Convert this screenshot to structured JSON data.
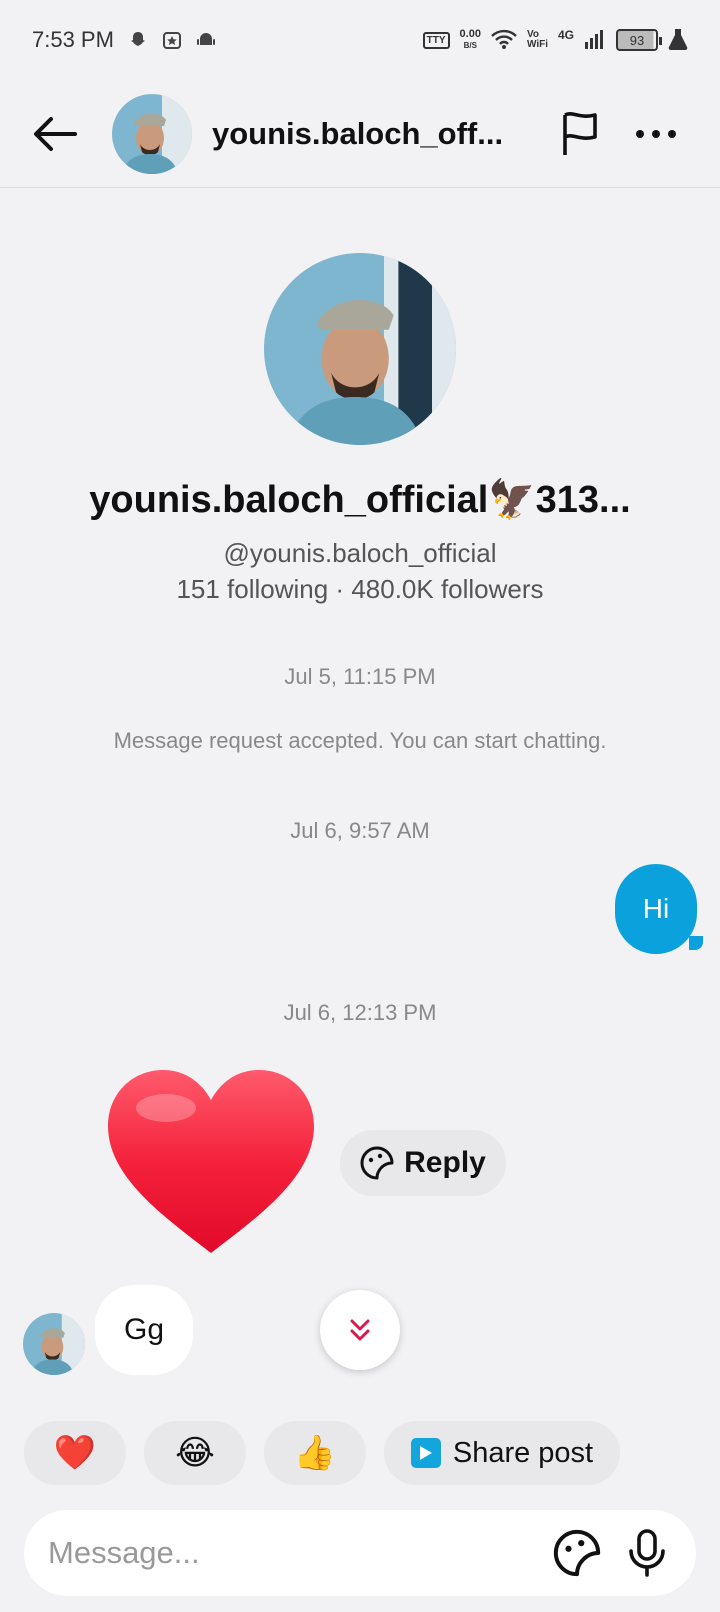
{
  "status_bar": {
    "time": "7:53 PM",
    "tty": "TTY",
    "net_speed": "0.00",
    "net_unit": "B/S",
    "vo": "Vo",
    "wifi_label": "WiFi",
    "network": "4G",
    "battery": "93"
  },
  "header": {
    "title": "younis.baloch_off...",
    "back_icon": "arrow-left-icon",
    "flag_icon": "flag-icon",
    "more_icon": "more-horizontal-icon"
  },
  "profile": {
    "name": "younis.baloch_official🦅313...",
    "handle": "@younis.baloch_official",
    "stats": "151 following · 480.0K followers"
  },
  "messages": {
    "ts1": "Jul 5, 11:15 PM",
    "system": "Message request accepted. You can start chatting.",
    "ts2": "Jul 6, 9:57 AM",
    "my_message": "Hi",
    "ts3": "Jul 6, 12:13 PM",
    "their_reaction": "heart",
    "reply_label": "Reply",
    "their_message": "Gg"
  },
  "quick_replies": {
    "r1": "❤️",
    "r2": "😂",
    "r3": "👍",
    "share_label": "Share post"
  },
  "composer": {
    "placeholder": "Message..."
  },
  "colors": {
    "accent": "#0aa1dc",
    "heart": "#f4223b",
    "background": "#f2f2f4"
  }
}
